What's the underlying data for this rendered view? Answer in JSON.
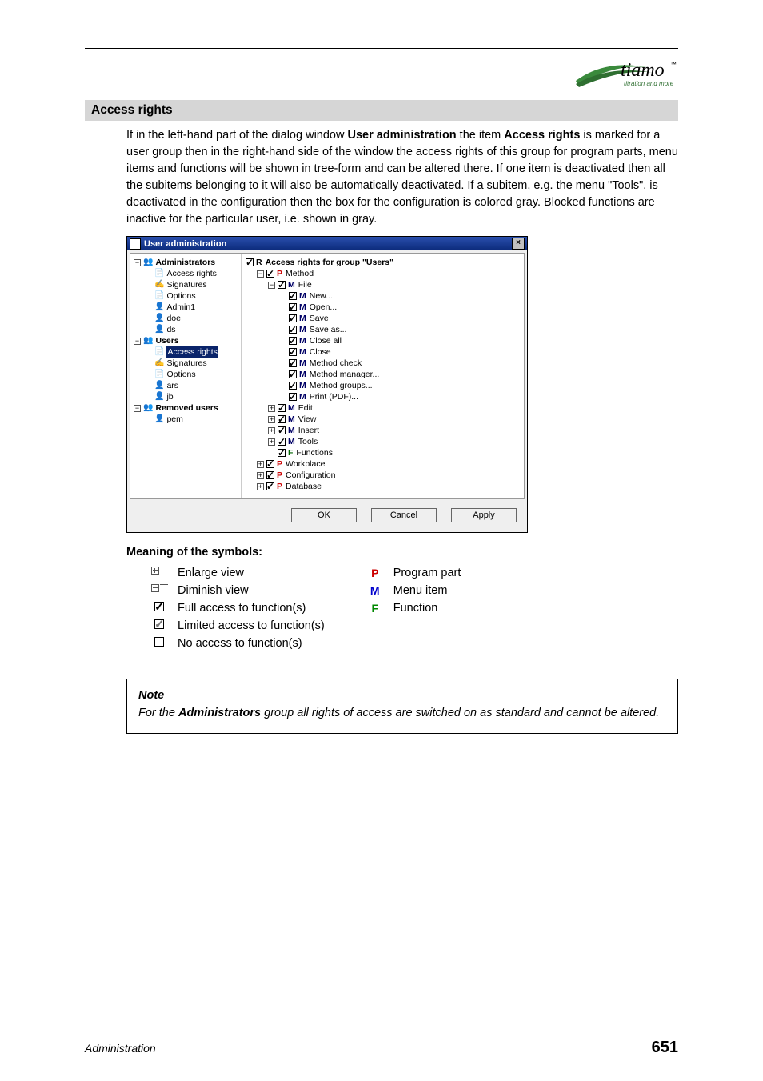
{
  "logo": {
    "brand": "tiamo",
    "tm": "™",
    "tagline": "titration and more"
  },
  "section_title": "Access rights",
  "paragraph": {
    "p1_pre": "If in the left-hand part of the dialog window ",
    "p1_bold1": "User administration",
    "p1_mid": " the item ",
    "p1_bold2": "Access rights",
    "p1_post": " is marked for a user group then in the right-hand side of the window the access rights of this group for program parts, menu items and functions will be shown in tree-form and can be altered there. If one item is deactivated then all the subitems belonging to it will also be automatically deactivated. If a subitem, e.g. the menu \"Tools\", is deactivated in the configuration then the box for the configuration is colored gray. Blocked functions are inactive for the particular user, i.e. shown in gray."
  },
  "dialog": {
    "title": "User administration",
    "close": "×",
    "left_tree": {
      "admins": {
        "label": "Administrators",
        "children": {
          "access": "Access rights",
          "sign": "Signatures",
          "opt": "Options",
          "u1": "Admin1",
          "u2": "doe",
          "u3": "ds"
        }
      },
      "users": {
        "label": "Users",
        "children": {
          "access": "Access rights",
          "sign": "Signatures",
          "opt": "Options",
          "u1": "ars",
          "u2": "jb"
        }
      },
      "removed": {
        "label": "Removed users",
        "children": {
          "u1": "pem"
        }
      }
    },
    "right_tree": {
      "root": "Access rights for group \"Users\"",
      "method": {
        "label": "Method",
        "file": {
          "label": "File",
          "items": [
            "New...",
            "Open...",
            "Save",
            "Save as...",
            "Close all",
            "Close",
            "Method check",
            "Method manager...",
            "Method groups...",
            "Print (PDF)..."
          ]
        },
        "edit": "Edit",
        "view": "View",
        "insert": "Insert",
        "tools": "Tools",
        "functions": "Functions"
      },
      "workplace": "Workplace",
      "configuration": "Configuration",
      "database": "Database"
    },
    "buttons": {
      "ok": "OK",
      "cancel": "Cancel",
      "apply": "Apply"
    }
  },
  "symbols": {
    "heading": "Meaning of the symbols:",
    "left": [
      {
        "key": "enlarge",
        "label": "Enlarge view"
      },
      {
        "key": "diminish",
        "label": "Diminish view"
      },
      {
        "key": "full",
        "label": "Full access to function(s)"
      },
      {
        "key": "partial",
        "label": "Limited access to function(s)"
      },
      {
        "key": "none",
        "label": "No access to function(s)"
      }
    ],
    "right": [
      {
        "letter": "P",
        "label": "Program part"
      },
      {
        "letter": "M",
        "label": "Menu item"
      },
      {
        "letter": "F",
        "label": "Function"
      }
    ]
  },
  "note": {
    "title": "Note",
    "t1": "For the ",
    "bold": "Administrators",
    "t2": " group all rights of access are switched on as standard and cannot be altered."
  },
  "footer": {
    "section": "Administration",
    "page": "651"
  }
}
